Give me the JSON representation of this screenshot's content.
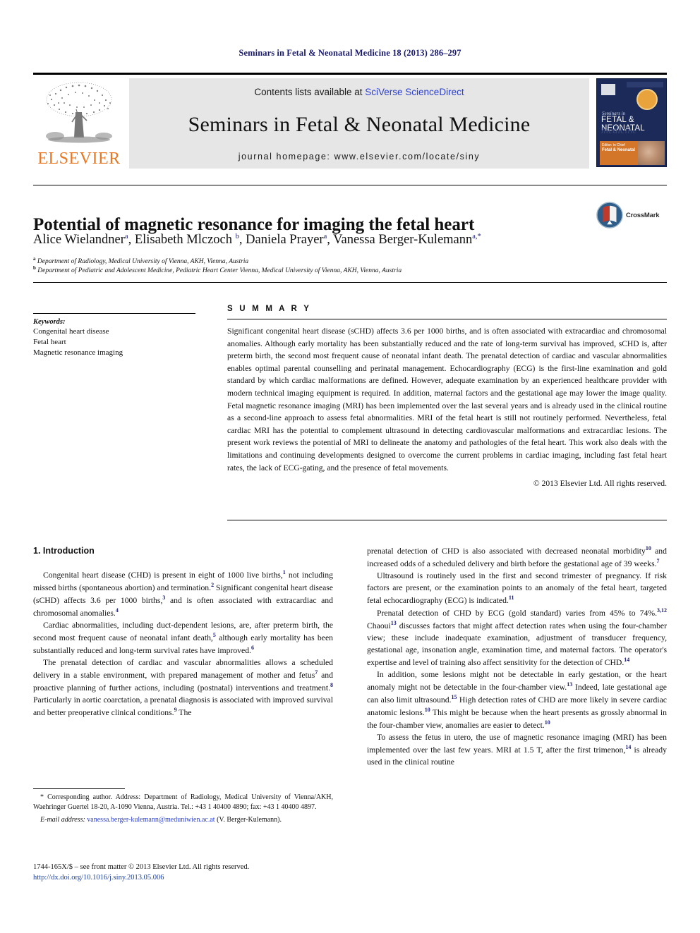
{
  "running_head": "Seminars in Fetal & Neonatal Medicine 18 (2013) 286–297",
  "masthead": {
    "publisher_name": "ELSEVIER",
    "contents_prefix": "Contents lists available at ",
    "contents_link": "SciVerse ScienceDirect",
    "journal_name": "Seminars in Fetal & Neonatal Medicine",
    "homepage": "journal homepage: www.elsevier.com/locate/siny",
    "cover": {
      "seminars_word": "Seminars in",
      "title_line": "FETAL & NEONATAL",
      "medicine_word": "medicine",
      "band_line1": "Editor: in Chief",
      "band_line2": "Fetal & Neonatal"
    }
  },
  "article": {
    "title": "Potential of magnetic resonance for imaging the fetal heart",
    "authors_html": "Alice Wielandner<sup>a</sup>, Elisabeth Mlczoch <sup>b</sup>, Daniela Prayer<sup>a</sup>, Vanessa Berger-Kulemann<sup>a,*</sup>",
    "affiliation_a": "Department of Radiology, Medical University of Vienna, AKH, Vienna, Austria",
    "affiliation_b": "Department of Pediatric and Adolescent Medicine, Pediatric Heart Center Vienna, Medical University of Vienna, AKH, Vienna, Austria",
    "crossmark_label": "CrossMark"
  },
  "keywords": {
    "heading": "Keywords:",
    "items": [
      "Congenital heart disease",
      "Fetal heart",
      "Magnetic resonance imaging"
    ]
  },
  "summary": {
    "heading": "S U M M A R Y",
    "body": "Significant congenital heart disease (sCHD) affects 3.6 per 1000 births, and is often associated with extracardiac and chromosomal anomalies. Although early mortality has been substantially reduced and the rate of long-term survival has improved, sCHD is, after preterm birth, the second most frequent cause of neonatal infant death. The prenatal detection of cardiac and vascular abnormalities enables optimal parental counselling and perinatal management. Echocardiography (ECG) is the first-line examination and gold standard by which cardiac malformations are defined. However, adequate examination by an experienced healthcare provider with modern technical imaging equipment is required. In addition, maternal factors and the gestational age may lower the image quality. Fetal magnetic resonance imaging (MRI) has been implemented over the last several years and is already used in the clinical routine as a second-line approach to assess fetal abnormalities. MRI of the fetal heart is still not routinely performed. Nevertheless, fetal cardiac MRI has the potential to complement ultrasound in detecting cardiovascular malformations and extracardiac lesions. The present work reviews the potential of MRI to delineate the anatomy and pathologies of the fetal heart. This work also deals with the limitations and continuing developments designed to overcome the current problems in cardiac imaging, including fast fetal heart rates, the lack of ECG-gating, and the presence of fetal movements.",
    "copyright": "© 2013 Elsevier Ltd. All rights reserved."
  },
  "body": {
    "section_heading": "1.  Introduction",
    "left_paragraphs_html": [
      "Congenital heart disease (CHD) is present in eight of 1000 live births,<sup class=\"ref\">1</sup> not including missed births (spontaneous abortion) and termination.<sup class=\"ref\">2</sup> Significant congenital heart disease (sCHD) affects 3.6 per 1000 births,<sup class=\"ref\">3</sup> and is often associated with extracardiac and chromosomal anomalies.<sup class=\"ref\">4</sup>",
      "Cardiac abnormalities, including duct-dependent lesions, are, after preterm birth, the second most frequent cause of neonatal infant death,<sup class=\"ref\">5</sup> although early mortality has been substantially reduced and long-term survival rates have improved.<sup class=\"ref\">6</sup>",
      "The prenatal detection of cardiac and vascular abnormalities allows a scheduled delivery in a stable environment, with prepared management of mother and fetus<sup class=\"ref\">7</sup> and proactive planning of further actions, including (postnatal) interventions and treatment.<sup class=\"ref\">8</sup> Particularly in aortic coarctation, a prenatal diagnosis is associated with improved survival and better preoperative clinical conditions.<sup class=\"ref\">9</sup> The"
    ],
    "right_paragraphs_html": [
      "prenatal detection of CHD is also associated with decreased neonatal morbidity<sup class=\"ref\">10</sup> and increased odds of a scheduled delivery and birth before the gestational age of 39 weeks.<sup class=\"ref\">7</sup>",
      "Ultrasound is routinely used in the first and second trimester of pregnancy. If risk factors are present, or the examination points to an anomaly of the fetal heart, targeted fetal echocardiography (ECG) is indicated.<sup class=\"ref\">11</sup>",
      "Prenatal detection of CHD by ECG (gold standard) varies from 45% to 74%.<sup class=\"ref\">3,12</sup> Chaoui<sup class=\"ref\">13</sup> discusses factors that might affect detection rates when using the four-chamber view; these include inadequate examination, adjustment of transducer frequency, gestational age, insonation angle, examination time, and maternal factors. The operator's expertise and level of training also affect sensitivity for the detection of CHD.<sup class=\"ref\">14</sup>",
      "In addition, some lesions might not be detectable in early gestation, or the heart anomaly might not be detectable in the four-chamber view.<sup class=\"ref\">13</sup> Indeed, late gestational age can also limit ultrasound.<sup class=\"ref\">15</sup> High detection rates of CHD are more likely in severe cardiac anatomic lesions.<sup class=\"ref\">10</sup> This might be because when the heart presents as grossly abnormal in the four-chamber view, anomalies are easier to detect.<sup class=\"ref\">10</sup>",
      "To assess the fetus in utero, the use of magnetic resonance imaging (MRI) has been implemented over the last few years. MRI at 1.5 T, after the first trimenon,<sup class=\"ref\">14</sup> is already used in the clinical routine"
    ]
  },
  "footnotes": {
    "corresponding_html": "* Corresponding author. Address: Department of Radiology, Medical University of Vienna/AKH, Waehringer Guertel 18-20, A-1090 Vienna, Austria. Tel.: +43 1 40400 4890; fax: +43 1 40400 4897.",
    "email_label": "E-mail address:",
    "email_address": "vanessa.berger-kulemann@meduniwien.ac.at",
    "email_suffix": "(V. Berger-Kulemann).",
    "frontmatter": "1744-165X/$ – see front matter © 2013 Elsevier Ltd. All rights reserved.",
    "doi": "http://dx.doi.org/10.1016/j.siny.2013.05.006"
  },
  "colors": {
    "elsevier_orange": "#E87722",
    "link_blue": "#2b3fd0",
    "ref_blue": "#1a1a6e",
    "cover_navy": "#1b2a58"
  }
}
